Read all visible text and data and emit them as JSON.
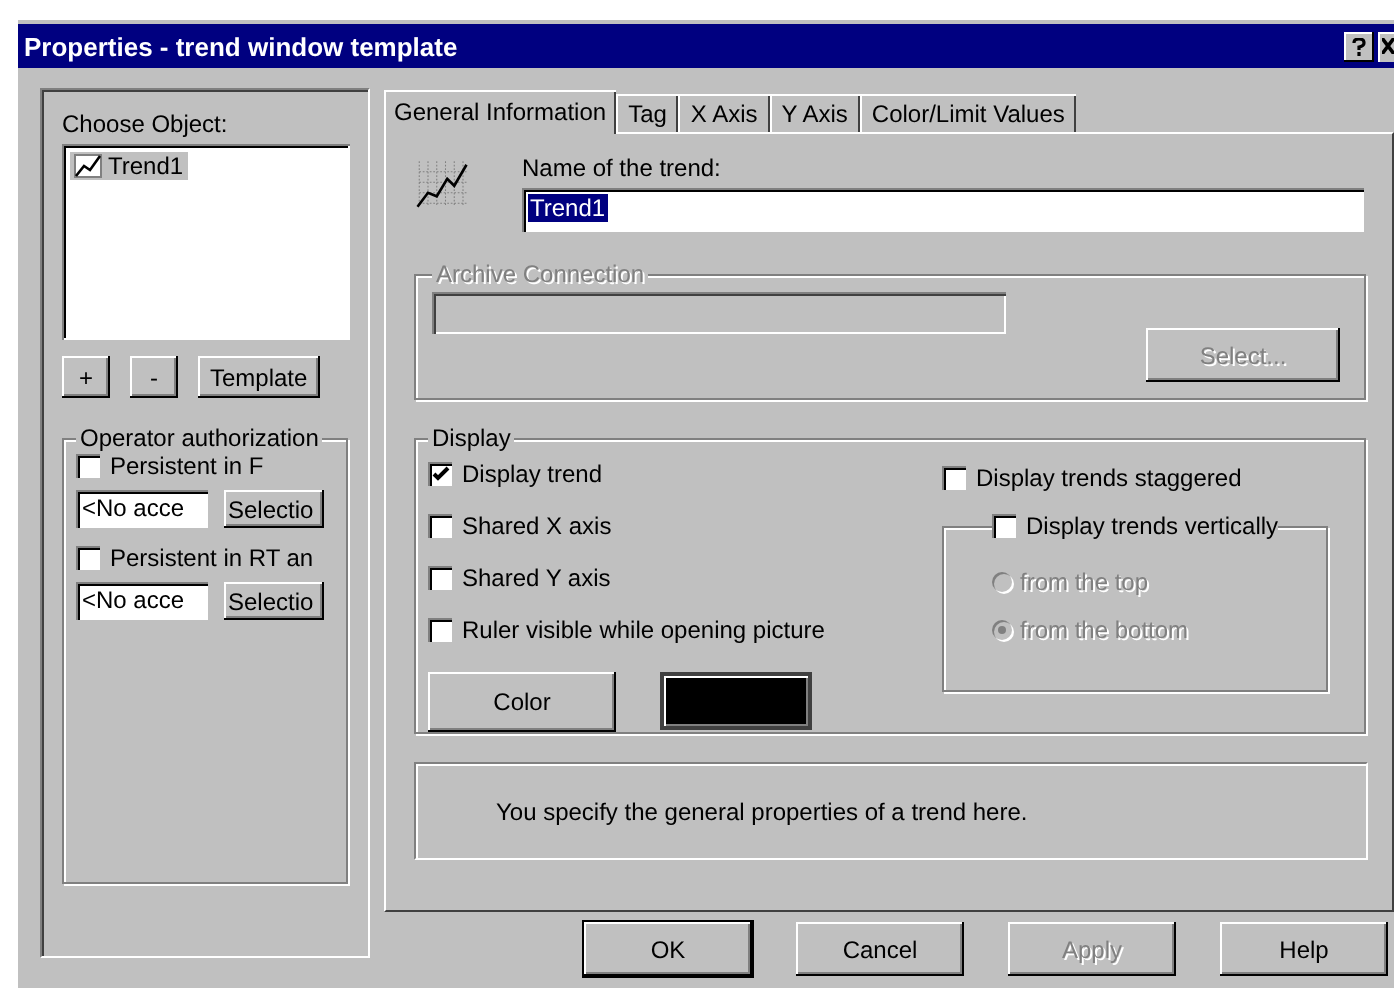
{
  "window": {
    "title": "Properties - trend window template"
  },
  "objects": {
    "label": "Choose Object:",
    "items": [
      {
        "label": "Trend1",
        "selected": true
      }
    ],
    "buttons": [
      "+",
      "-",
      "Template"
    ]
  },
  "authorization": {
    "title": "Operator authorization",
    "items": [
      {
        "label": "Persistent in F",
        "checked": false,
        "value": "<No acce",
        "button": "Selectio"
      },
      {
        "label": "Persistent in RT an",
        "checked": false,
        "value": "<No acce",
        "button": "Selectio"
      }
    ]
  },
  "tabs": [
    {
      "label": "General Information",
      "selected": true
    },
    {
      "label": "Tag",
      "selected": false
    },
    {
      "label": "X Axis",
      "selected": false
    },
    {
      "label": "Y Axis",
      "selected": false
    },
    {
      "label": "Color/Limit Values",
      "selected": false
    }
  ],
  "name": {
    "label": "Name of the trend:",
    "value": "Trend1"
  },
  "archive": {
    "title": "Archive Connection",
    "disabled": true,
    "button": "Select..."
  },
  "display": {
    "title": "Display",
    "options": [
      {
        "label": "Display trend",
        "checked": true
      },
      {
        "label": "Shared X axis",
        "checked": false
      },
      {
        "label": "Shared Y axis",
        "checked": false
      },
      {
        "label": "Ruler visible while opening picture",
        "checked": false
      }
    ],
    "color_button": "Color",
    "color": "#000000",
    "staggered": {
      "label": "Display trends staggered",
      "checked": false
    },
    "vertical": {
      "label": "Display trends vertically",
      "checked": false,
      "options": [
        {
          "label": "from the top",
          "selected": false
        },
        {
          "label": "from the bottom",
          "selected": true
        }
      ]
    }
  },
  "description": "You specify the general properties of a trend here.",
  "buttons": [
    {
      "label": "OK",
      "disabled": false,
      "default": true
    },
    {
      "label": "Cancel",
      "disabled": false,
      "default": false
    },
    {
      "label": "Apply",
      "disabled": true,
      "default": false
    },
    {
      "label": "Help",
      "disabled": false,
      "default": false
    }
  ]
}
